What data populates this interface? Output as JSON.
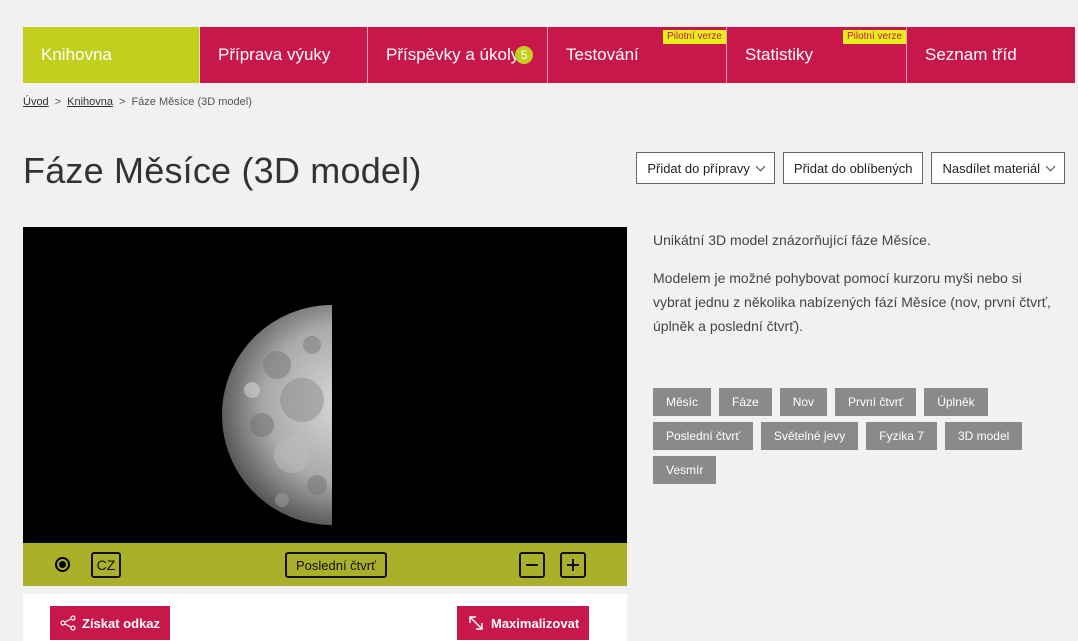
{
  "nav": {
    "items": [
      {
        "label": "Knihovna",
        "active": true,
        "badge": "",
        "pilot": ""
      },
      {
        "label": "Příprava výuky",
        "active": false,
        "badge": "",
        "pilot": ""
      },
      {
        "label": "Příspěvky a úkoly",
        "active": false,
        "badge": "5",
        "pilot": ""
      },
      {
        "label": "Testování",
        "active": false,
        "badge": "",
        "pilot": "Pilotní verze"
      },
      {
        "label": "Statistiky",
        "active": false,
        "badge": "",
        "pilot": "Pilotní verze"
      },
      {
        "label": "Seznam tříd",
        "active": false,
        "badge": "",
        "pilot": ""
      }
    ]
  },
  "breadcrumb": {
    "home": "Úvod",
    "sep": ">",
    "library": "Knihovna",
    "current": "Fáze Měsíce (3D model)"
  },
  "page": {
    "title": "Fáze Měsíce (3D model)"
  },
  "actions": {
    "add_prep": "Přidat do přípravy",
    "add_fav": "Přidat do oblíbených",
    "share": "Nasdílet materiál"
  },
  "viewer": {
    "language": "CZ",
    "phase": "Poslední čtvrť"
  },
  "buttons": {
    "get_link": "Získat odkaz",
    "maximize": "Maximalizovat"
  },
  "description": {
    "p1": "Unikátní 3D model znázorňující fáze Měsíce.",
    "p2": "Modelem je možné pohybovat pomocí kurzoru myši nebo si vybrat jednu z několika nabízených fází Měsíce (nov, první čtvrť, úplněk a poslední čtvrť)."
  },
  "tags": [
    "Měsíc",
    "Fáze",
    "Nov",
    "První čtvrť",
    "Úplněk",
    "Poslední čtvrť",
    "Světelné jevy",
    "Fyzika 7",
    "3D model",
    "Vesmír"
  ],
  "colors": {
    "brand": "#c8174a",
    "accent": "#c2cf1f",
    "controls": "#aab02a",
    "tag": "#8a8a8a"
  }
}
